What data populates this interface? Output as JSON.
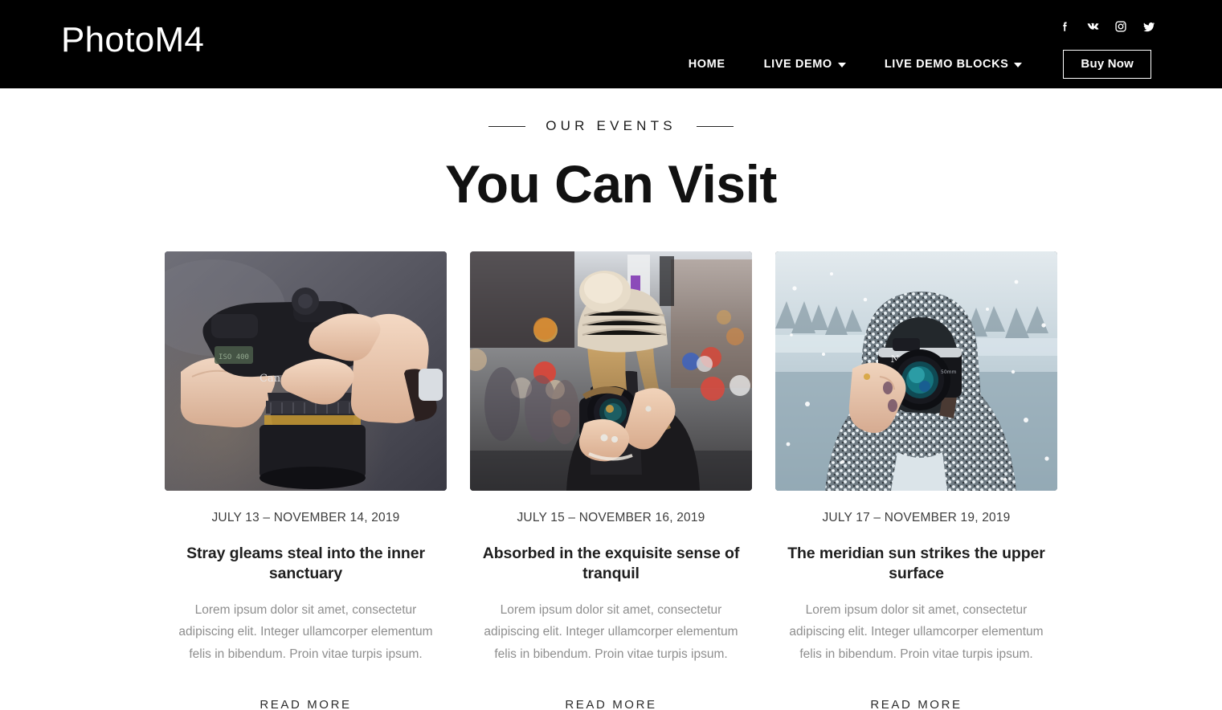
{
  "header": {
    "logo": "PhotoM4",
    "nav": [
      {
        "label": "HOME",
        "has_caret": false
      },
      {
        "label": "LIVE DEMO",
        "has_caret": true
      },
      {
        "label": "LIVE DEMO BLOCKS",
        "has_caret": true
      }
    ],
    "buy_now_label": "Buy Now",
    "social": [
      {
        "name": "facebook-icon",
        "label": "Facebook"
      },
      {
        "name": "vk-icon",
        "label": "VK"
      },
      {
        "name": "instagram-icon",
        "label": "Instagram"
      },
      {
        "name": "twitter-icon",
        "label": "Twitter"
      }
    ],
    "background_color": "#000000",
    "text_color": "#ffffff"
  },
  "section": {
    "eyebrow": "OUR EVENTS",
    "title": "You Can Visit"
  },
  "cards": [
    {
      "date": "JULY 13 – NOVEMBER 14, 2019",
      "title": "Stray gleams steal into the inner sanctuary",
      "text": "Lorem ipsum dolor sit amet, consectetur adipiscing elit. Integer ullamcorper elementum felis in bibendum. Proin vitae turpis ipsum.",
      "read_more": "READ MORE",
      "image_alt": "Hands holding a black Canon DSLR camera against a grey background"
    },
    {
      "date": "JULY 15 – NOVEMBER 16, 2019",
      "title": "Absorbed in the exquisite sense of tranquil",
      "text": "Lorem ipsum dolor sit amet, consectetur adipiscing elit. Integer ullamcorper elementum felis in bibendum. Proin vitae turpis ipsum.",
      "read_more": "READ MORE",
      "image_alt": "Woman in a cream bobble hat photographing on a city street with colourful bokeh lights"
    },
    {
      "date": "JULY 17 – NOVEMBER 19, 2019",
      "title": "The meridian sun strikes the upper surface",
      "text": "Lorem ipsum dolor sit amet, consectetur adipiscing elit. Integer ullamcorper elementum felis in bibendum. Proin vitae turpis ipsum.",
      "read_more": "READ MORE",
      "image_alt": "Person in a grey speckled hooded coat holding a Nikon camera in falling snow by a lake"
    }
  ],
  "colors": {
    "page_background": "#ffffff",
    "heading": "#111111",
    "body_text": "#8e8e8e",
    "date_text": "#3d3d3d"
  }
}
